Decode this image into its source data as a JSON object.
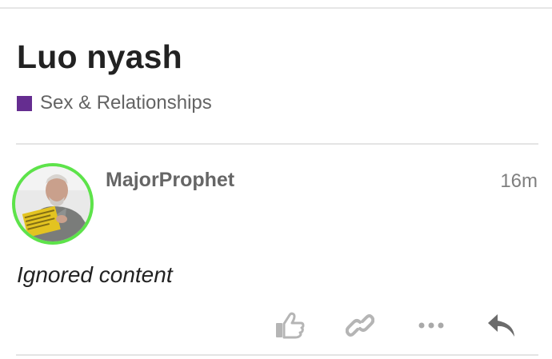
{
  "topic": {
    "title": "Luo nyash",
    "category": {
      "label": "Sex & Relationships",
      "color": "#652d90"
    }
  },
  "post": {
    "username": "MajorProphet",
    "time": "16m",
    "body": "Ignored content",
    "avatar_ring_color": "#5de34a",
    "actions": [
      {
        "name": "like",
        "icon": "thumbs-up-icon"
      },
      {
        "name": "copy-link",
        "icon": "link-icon"
      },
      {
        "name": "more",
        "icon": "ellipsis-icon"
      },
      {
        "name": "reply",
        "icon": "reply-arrow-icon"
      }
    ]
  }
}
